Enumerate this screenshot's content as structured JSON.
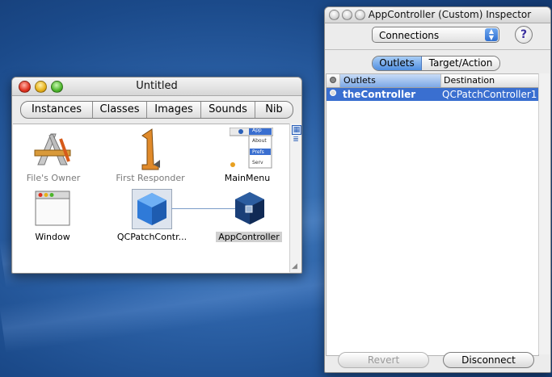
{
  "nib_window": {
    "title": "Untitled",
    "tabs": [
      "Instances",
      "Classes",
      "Images",
      "Sounds",
      "Nib"
    ],
    "objects": [
      {
        "label": "File's Owner",
        "icon": "app-icon"
      },
      {
        "label": "First Responder",
        "icon": "first-responder-icon"
      },
      {
        "label": "MainMenu",
        "icon": "menu-icon"
      },
      {
        "label": "Window",
        "icon": "window-icon"
      },
      {
        "label": "QCPatchContr...",
        "icon": "cube-icon"
      },
      {
        "label": "AppController",
        "icon": "cube-icon"
      }
    ],
    "menu_preview": [
      "App",
      "About",
      "Prefs",
      "Serv"
    ]
  },
  "inspector": {
    "title": "AppController (Custom) Inspector",
    "popup_value": "Connections",
    "help_label": "?",
    "segments": [
      "Outlets",
      "Target/Action"
    ],
    "columns": [
      "Outlets",
      "Destination"
    ],
    "rows": [
      {
        "outlet": "theController",
        "destination": "QCPatchController1"
      }
    ],
    "revert_label": "Revert",
    "disconnect_label": "Disconnect"
  },
  "colors": {
    "selection": "#3a6fd0",
    "desktop": "#2e64aa"
  }
}
